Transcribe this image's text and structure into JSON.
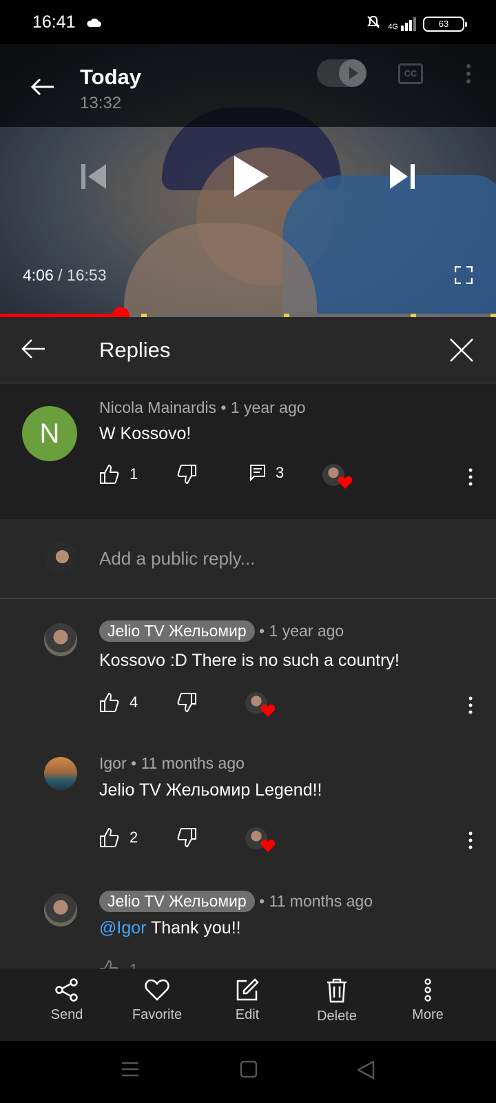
{
  "status_bar": {
    "time": "16:41",
    "network": "4G",
    "battery": "63"
  },
  "video": {
    "title": "Today",
    "subtitle": "13:32",
    "current_time": "4:06",
    "separator": " / ",
    "duration": "16:53",
    "progress_fraction": 0.243
  },
  "replies": {
    "title": "Replies",
    "parent": {
      "author": "Nicola Mainardis",
      "age": "• 1 year ago",
      "text": "W Kossovo!",
      "avatar_letter": "N",
      "likes": "1",
      "reply_count": "3"
    },
    "reply_placeholder": "Add a public reply...",
    "items": [
      {
        "author": "Jelio TV Жельомир",
        "age": "• 1 year ago",
        "text": "Kossovo :D There is no such a country!",
        "likes": "4"
      },
      {
        "author": "Igor",
        "age": "• 11 months ago",
        "text": "Jelio TV Жельомир Legend!!",
        "likes": "2"
      },
      {
        "author": "Jelio TV Жельомир",
        "age": "• 11 months ago",
        "mention": "@Igor",
        "text": " Thank you!!",
        "likes": "1"
      }
    ]
  },
  "bottom_actions": [
    {
      "label": "Send",
      "icon": "share-icon"
    },
    {
      "label": "Favorite",
      "icon": "heart-icon"
    },
    {
      "label": "Edit",
      "icon": "edit-icon"
    },
    {
      "label": "Delete",
      "icon": "trash-icon"
    },
    {
      "label": "More",
      "icon": "more-icon"
    }
  ],
  "colors": {
    "accent_red": "#ff0000",
    "mention_blue": "#3ea6ff",
    "avatar_green": "#6a9f3d"
  }
}
